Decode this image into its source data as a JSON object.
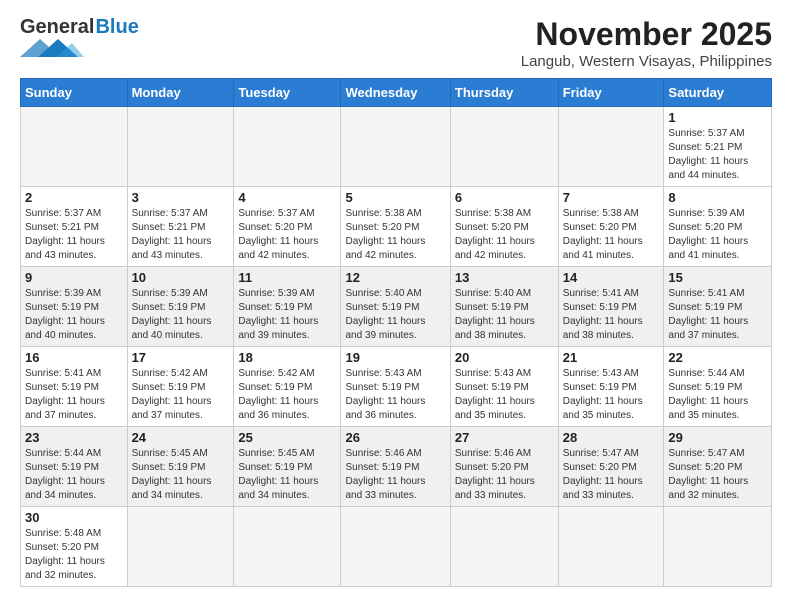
{
  "header": {
    "logo_general": "General",
    "logo_blue": "Blue",
    "month_title": "November 2025",
    "location": "Langub, Western Visayas, Philippines"
  },
  "weekdays": [
    "Sunday",
    "Monday",
    "Tuesday",
    "Wednesday",
    "Thursday",
    "Friday",
    "Saturday"
  ],
  "weeks": [
    {
      "shaded": false,
      "days": [
        {
          "num": "",
          "info": ""
        },
        {
          "num": "",
          "info": ""
        },
        {
          "num": "",
          "info": ""
        },
        {
          "num": "",
          "info": ""
        },
        {
          "num": "",
          "info": ""
        },
        {
          "num": "",
          "info": ""
        },
        {
          "num": "1",
          "info": "Sunrise: 5:37 AM\nSunset: 5:21 PM\nDaylight: 11 hours\nand 44 minutes."
        }
      ]
    },
    {
      "shaded": false,
      "days": [
        {
          "num": "2",
          "info": "Sunrise: 5:37 AM\nSunset: 5:21 PM\nDaylight: 11 hours\nand 43 minutes."
        },
        {
          "num": "3",
          "info": "Sunrise: 5:37 AM\nSunset: 5:21 PM\nDaylight: 11 hours\nand 43 minutes."
        },
        {
          "num": "4",
          "info": "Sunrise: 5:37 AM\nSunset: 5:20 PM\nDaylight: 11 hours\nand 42 minutes."
        },
        {
          "num": "5",
          "info": "Sunrise: 5:38 AM\nSunset: 5:20 PM\nDaylight: 11 hours\nand 42 minutes."
        },
        {
          "num": "6",
          "info": "Sunrise: 5:38 AM\nSunset: 5:20 PM\nDaylight: 11 hours\nand 42 minutes."
        },
        {
          "num": "7",
          "info": "Sunrise: 5:38 AM\nSunset: 5:20 PM\nDaylight: 11 hours\nand 41 minutes."
        },
        {
          "num": "8",
          "info": "Sunrise: 5:39 AM\nSunset: 5:20 PM\nDaylight: 11 hours\nand 41 minutes."
        }
      ]
    },
    {
      "shaded": true,
      "days": [
        {
          "num": "9",
          "info": "Sunrise: 5:39 AM\nSunset: 5:19 PM\nDaylight: 11 hours\nand 40 minutes."
        },
        {
          "num": "10",
          "info": "Sunrise: 5:39 AM\nSunset: 5:19 PM\nDaylight: 11 hours\nand 40 minutes."
        },
        {
          "num": "11",
          "info": "Sunrise: 5:39 AM\nSunset: 5:19 PM\nDaylight: 11 hours\nand 39 minutes."
        },
        {
          "num": "12",
          "info": "Sunrise: 5:40 AM\nSunset: 5:19 PM\nDaylight: 11 hours\nand 39 minutes."
        },
        {
          "num": "13",
          "info": "Sunrise: 5:40 AM\nSunset: 5:19 PM\nDaylight: 11 hours\nand 38 minutes."
        },
        {
          "num": "14",
          "info": "Sunrise: 5:41 AM\nSunset: 5:19 PM\nDaylight: 11 hours\nand 38 minutes."
        },
        {
          "num": "15",
          "info": "Sunrise: 5:41 AM\nSunset: 5:19 PM\nDaylight: 11 hours\nand 37 minutes."
        }
      ]
    },
    {
      "shaded": false,
      "days": [
        {
          "num": "16",
          "info": "Sunrise: 5:41 AM\nSunset: 5:19 PM\nDaylight: 11 hours\nand 37 minutes."
        },
        {
          "num": "17",
          "info": "Sunrise: 5:42 AM\nSunset: 5:19 PM\nDaylight: 11 hours\nand 37 minutes."
        },
        {
          "num": "18",
          "info": "Sunrise: 5:42 AM\nSunset: 5:19 PM\nDaylight: 11 hours\nand 36 minutes."
        },
        {
          "num": "19",
          "info": "Sunrise: 5:43 AM\nSunset: 5:19 PM\nDaylight: 11 hours\nand 36 minutes."
        },
        {
          "num": "20",
          "info": "Sunrise: 5:43 AM\nSunset: 5:19 PM\nDaylight: 11 hours\nand 35 minutes."
        },
        {
          "num": "21",
          "info": "Sunrise: 5:43 AM\nSunset: 5:19 PM\nDaylight: 11 hours\nand 35 minutes."
        },
        {
          "num": "22",
          "info": "Sunrise: 5:44 AM\nSunset: 5:19 PM\nDaylight: 11 hours\nand 35 minutes."
        }
      ]
    },
    {
      "shaded": true,
      "days": [
        {
          "num": "23",
          "info": "Sunrise: 5:44 AM\nSunset: 5:19 PM\nDaylight: 11 hours\nand 34 minutes."
        },
        {
          "num": "24",
          "info": "Sunrise: 5:45 AM\nSunset: 5:19 PM\nDaylight: 11 hours\nand 34 minutes."
        },
        {
          "num": "25",
          "info": "Sunrise: 5:45 AM\nSunset: 5:19 PM\nDaylight: 11 hours\nand 34 minutes."
        },
        {
          "num": "26",
          "info": "Sunrise: 5:46 AM\nSunset: 5:19 PM\nDaylight: 11 hours\nand 33 minutes."
        },
        {
          "num": "27",
          "info": "Sunrise: 5:46 AM\nSunset: 5:20 PM\nDaylight: 11 hours\nand 33 minutes."
        },
        {
          "num": "28",
          "info": "Sunrise: 5:47 AM\nSunset: 5:20 PM\nDaylight: 11 hours\nand 33 minutes."
        },
        {
          "num": "29",
          "info": "Sunrise: 5:47 AM\nSunset: 5:20 PM\nDaylight: 11 hours\nand 32 minutes."
        }
      ]
    },
    {
      "shaded": false,
      "days": [
        {
          "num": "30",
          "info": "Sunrise: 5:48 AM\nSunset: 5:20 PM\nDaylight: 11 hours\nand 32 minutes."
        },
        {
          "num": "",
          "info": ""
        },
        {
          "num": "",
          "info": ""
        },
        {
          "num": "",
          "info": ""
        },
        {
          "num": "",
          "info": ""
        },
        {
          "num": "",
          "info": ""
        },
        {
          "num": "",
          "info": ""
        }
      ]
    }
  ]
}
